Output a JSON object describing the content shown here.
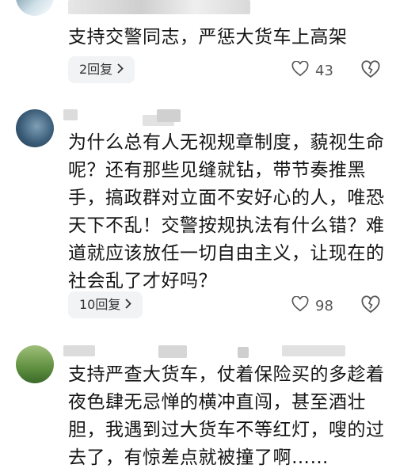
{
  "comments": [
    {
      "text": "支持交警同志，严惩大货车上高架",
      "reply_label": "2回复",
      "likes": "43"
    },
    {
      "text": "为什么总有人无视规章制度，藐视生命呢？还有那些见缝就钻，带节奏推黑手，搞政群对立面不安好心的人，唯恐天下不乱！交警按规执法有什么错？难道就应该放任一切自由主义，让现在的社会乱了才好吗？",
      "reply_label": "10回复",
      "likes": "98"
    },
    {
      "text": "支持严查大货车，仗着保险买的多趁着夜色肆无忌惮的横冲直闯，甚至酒壮胆，我遇到过大货车不等红灯，嗖的过去了，有惊差点就被撞了啊……"
    }
  ],
  "icons": {
    "heart": "heart-outline-icon",
    "dislike": "broken-heart-icon",
    "chevron": "chevron-right-icon"
  }
}
